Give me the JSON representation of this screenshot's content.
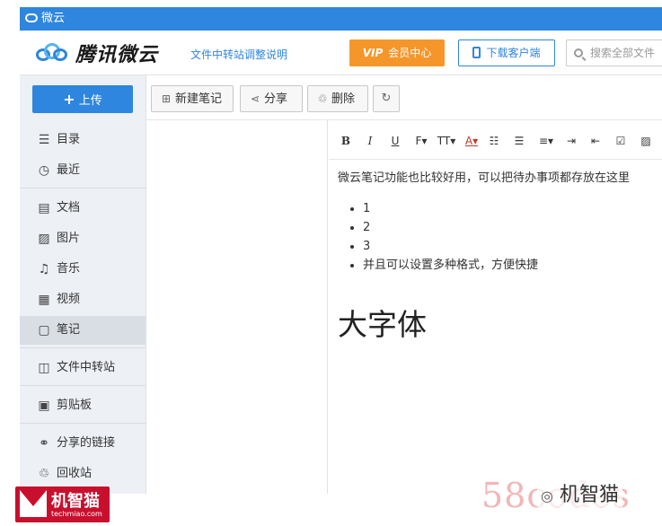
{
  "window": {
    "title": "微云"
  },
  "header": {
    "logo_text": "腾讯微云",
    "notice_link": "文件中转站调整说明",
    "vip_badge": "VIP",
    "vip_label": "会员中心",
    "download_label": "下载客户端",
    "search_placeholder": "搜索全部文件"
  },
  "sidebar": {
    "upload_label": "上传",
    "items": [
      {
        "label": "目录",
        "icon": "list-icon"
      },
      {
        "label": "最近",
        "icon": "clock-icon"
      },
      {
        "label": "文档",
        "icon": "document-icon"
      },
      {
        "label": "图片",
        "icon": "image-icon"
      },
      {
        "label": "音乐",
        "icon": "music-icon"
      },
      {
        "label": "视频",
        "icon": "video-icon"
      },
      {
        "label": "笔记",
        "icon": "note-icon",
        "active": true
      },
      {
        "label": "文件中转站",
        "icon": "transfer-icon"
      },
      {
        "label": "剪贴板",
        "icon": "clipboard-icon"
      },
      {
        "label": "分享的链接",
        "icon": "link-icon"
      },
      {
        "label": "回收站",
        "icon": "trash-icon"
      }
    ]
  },
  "toolbar": {
    "new_note_label": "新建笔记",
    "share_label": "分享",
    "delete_label": "删除"
  },
  "format_bar": {
    "bold": "B",
    "italic": "I",
    "underline": "U",
    "font": "F",
    "size": "TT",
    "color": "A"
  },
  "note": {
    "paragraph": "微云笔记功能也比较好用，可以把待办事项都存放在这里",
    "bullets": [
      "1",
      "2",
      "3",
      "并且可以设置多种格式，方便快捷"
    ],
    "big_text": "大字体"
  },
  "watermarks": {
    "left_title": "机智猫",
    "left_sub": "techmiao.com",
    "right_code": "58codes",
    "right_name": "机智猫"
  }
}
